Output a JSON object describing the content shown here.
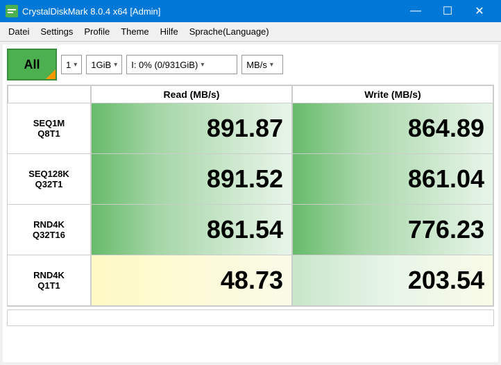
{
  "window": {
    "title": "CrystalDiskMark 8.0.4 x64 [Admin]",
    "icon_label": "CDM"
  },
  "title_controls": {
    "minimize": "—",
    "maximize": "☐",
    "close": "✕"
  },
  "menu": {
    "items": [
      "Datei",
      "Settings",
      "Profile",
      "Theme",
      "Hilfe",
      "Sprache(Language)"
    ]
  },
  "toolbar": {
    "all_button": "All",
    "runs_value": "1",
    "runs_arrow": "▾",
    "size_value": "1GiB",
    "size_arrow": "▾",
    "drive_value": "I: 0% (0/931GiB)",
    "drive_arrow": "▾",
    "unit_value": "MB/s",
    "unit_arrow": "▾"
  },
  "grid": {
    "header": {
      "col1": "",
      "col2": "Read (MB/s)",
      "col3": "Write (MB/s)"
    },
    "rows": [
      {
        "label_line1": "SEQ1M",
        "label_line2": "Q8T1",
        "read": "891.87",
        "write": "864.89",
        "read_style": "normal",
        "write_style": "normal"
      },
      {
        "label_line1": "SEQ128K",
        "label_line2": "Q32T1",
        "read": "891.52",
        "write": "861.04",
        "read_style": "normal",
        "write_style": "normal"
      },
      {
        "label_line1": "RND4K",
        "label_line2": "Q32T16",
        "read": "861.54",
        "write": "776.23",
        "read_style": "normal",
        "write_style": "normal"
      },
      {
        "label_line1": "RND4K",
        "label_line2": "Q1T1",
        "read": "48.73",
        "write": "203.54",
        "read_style": "light",
        "write_style": "light-write"
      }
    ]
  }
}
